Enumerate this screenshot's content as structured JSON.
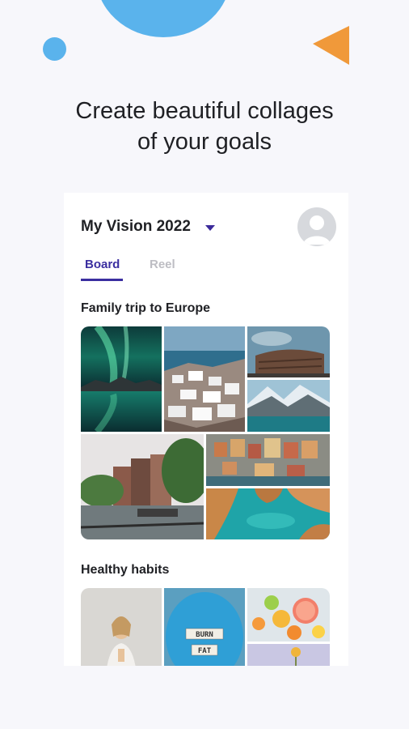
{
  "headline": {
    "line1": "Create beautiful collages",
    "line2": "of your goals"
  },
  "board": {
    "title": "My Vision 2022",
    "dropdown_icon": "caret-down-icon",
    "avatar_icon": "user-avatar-icon",
    "tabs": [
      {
        "label": "Board",
        "active": true
      },
      {
        "label": "Reel",
        "active": false
      }
    ]
  },
  "sections": [
    {
      "title": "Family trip to Europe",
      "images": [
        "aurora-lake-photo",
        "santorini-photo",
        "colosseum-photo",
        "alpine-lake-photo",
        "amsterdam-canal-photo",
        "cinque-terre-photo",
        "algarve-cove-photo"
      ]
    },
    {
      "title": "Healthy habits",
      "images": [
        "meditation-photo",
        "burn-fat-plate-photo",
        "citrus-fruit-photo",
        "flower-photo"
      ],
      "burn_text": "BURN",
      "fat_text": "FAT"
    }
  ],
  "colors": {
    "accent": "#3b2fa0",
    "blue": "#5ab3ec",
    "orange": "#f0993a",
    "caret": "#3b2a9a"
  }
}
